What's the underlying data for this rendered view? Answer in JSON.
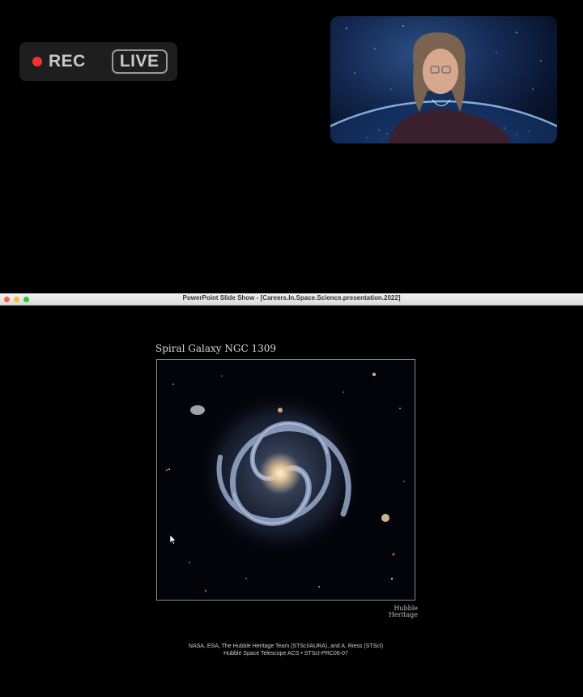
{
  "recording": {
    "rec_label": "REC",
    "live_label": "LIVE",
    "rec_color": "#ff2d2d"
  },
  "speaker_video": {
    "background": "earth-from-space"
  },
  "window": {
    "title": "PowerPoint Slide Show - [Careers.In.Space.Science.presentation.2022]",
    "traffic_light_colors": [
      "#fe5f57",
      "#febc2e",
      "#28c840"
    ]
  },
  "slide": {
    "title": "Spiral Galaxy NGC 1309",
    "logo_line1": "Hubble",
    "logo_line2": "Heritage",
    "credit_line1": "NASA, ESA, The Hubble Heritage Team (STScI/AURA), and A. Riess (STScI)",
    "credit_line2": "Hubble Space Telescope ACS • STScI-PRC06-07"
  },
  "icons": [
    "record-dot-icon",
    "mouse-pointer-icon"
  ]
}
